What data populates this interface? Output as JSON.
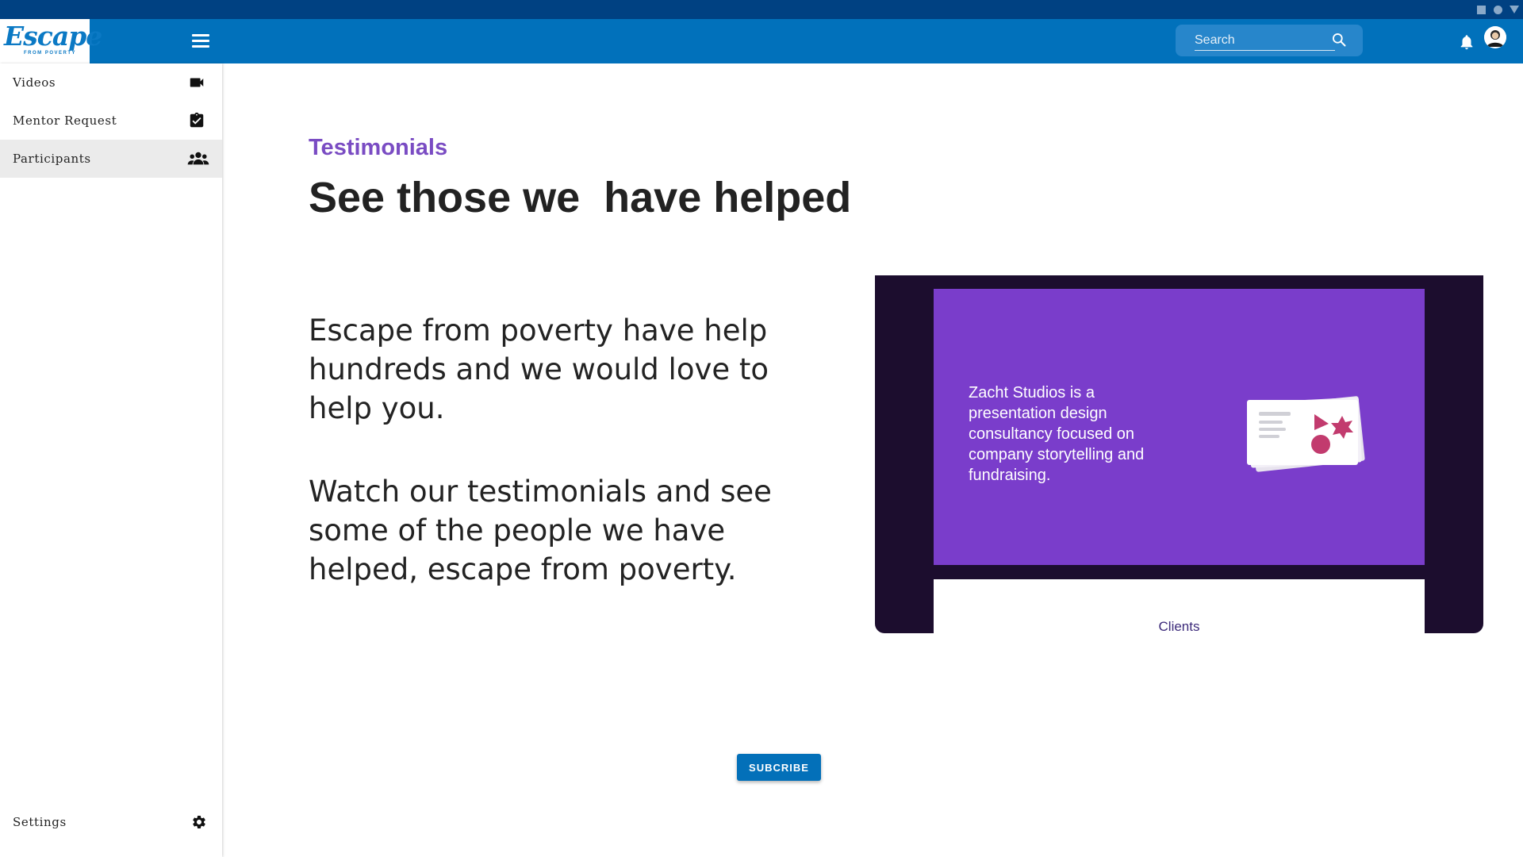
{
  "app": {
    "logo_text": "Escape",
    "logo_subtext": "FROM POVERTY"
  },
  "header": {
    "search_placeholder": "Search"
  },
  "sidebar": {
    "items": [
      {
        "label": "Videos",
        "icon": "video-camera-icon"
      },
      {
        "label": "Mentor Request",
        "icon": "clipboard-check-icon"
      },
      {
        "label": "Participants",
        "icon": "group-icon",
        "active": true
      }
    ],
    "settings_label": "Settings"
  },
  "main": {
    "eyebrow": "Testimonials",
    "headline": "See those we  have helped",
    "paragraph_1": "Escape from poverty have help hundreds and we would love to help you.",
    "paragraph_2": "Watch our testimonials and see some of the people we have helped, escape from poverty.",
    "video": {
      "slide_text": "Zacht Studios is a presentation design consultancy focused on company storytelling and fundraising.",
      "caption": "Clients"
    },
    "subscribe_label": "SUBCRIBE"
  },
  "colors": {
    "appbar": "#0171bb",
    "sysbar": "#004182",
    "accent_purple": "#7a4cc3",
    "slide_purple": "#7a3dcb",
    "video_bg": "#1c0d2e"
  }
}
